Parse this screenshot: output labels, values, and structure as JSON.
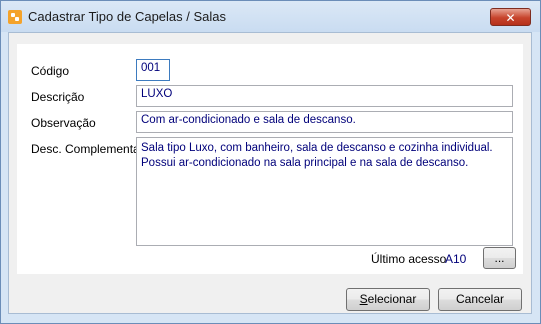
{
  "window": {
    "title": "Cadastrar Tipo de Capelas / Salas",
    "close_glyph": "✕"
  },
  "form": {
    "codigo": {
      "label": "Código",
      "value": "001"
    },
    "descricao": {
      "label": "Descrição",
      "value": "LUXO"
    },
    "observacao": {
      "label": "Observação",
      "value": "Com ar-condicionado e sala de descanso."
    },
    "desc_complementar": {
      "label": "Desc. Complementar",
      "value": "Sala tipo Luxo, com banheiro, sala de descanso e cozinha individual. Possui ar-condicionado na sala principal e na sala de descanso."
    },
    "ultimo_acesso": {
      "label": "Último acesso",
      "value": "A10"
    },
    "ellipsis_label": "..."
  },
  "buttons": {
    "selecionar": {
      "first": "S",
      "rest": "elecionar"
    },
    "cancelar": {
      "label": "Cancelar"
    }
  },
  "colors": {
    "value_text": "#00007a",
    "close_button": "#c7442c"
  },
  "icons": {
    "app": "app-logo-icon",
    "close": "close-icon"
  }
}
